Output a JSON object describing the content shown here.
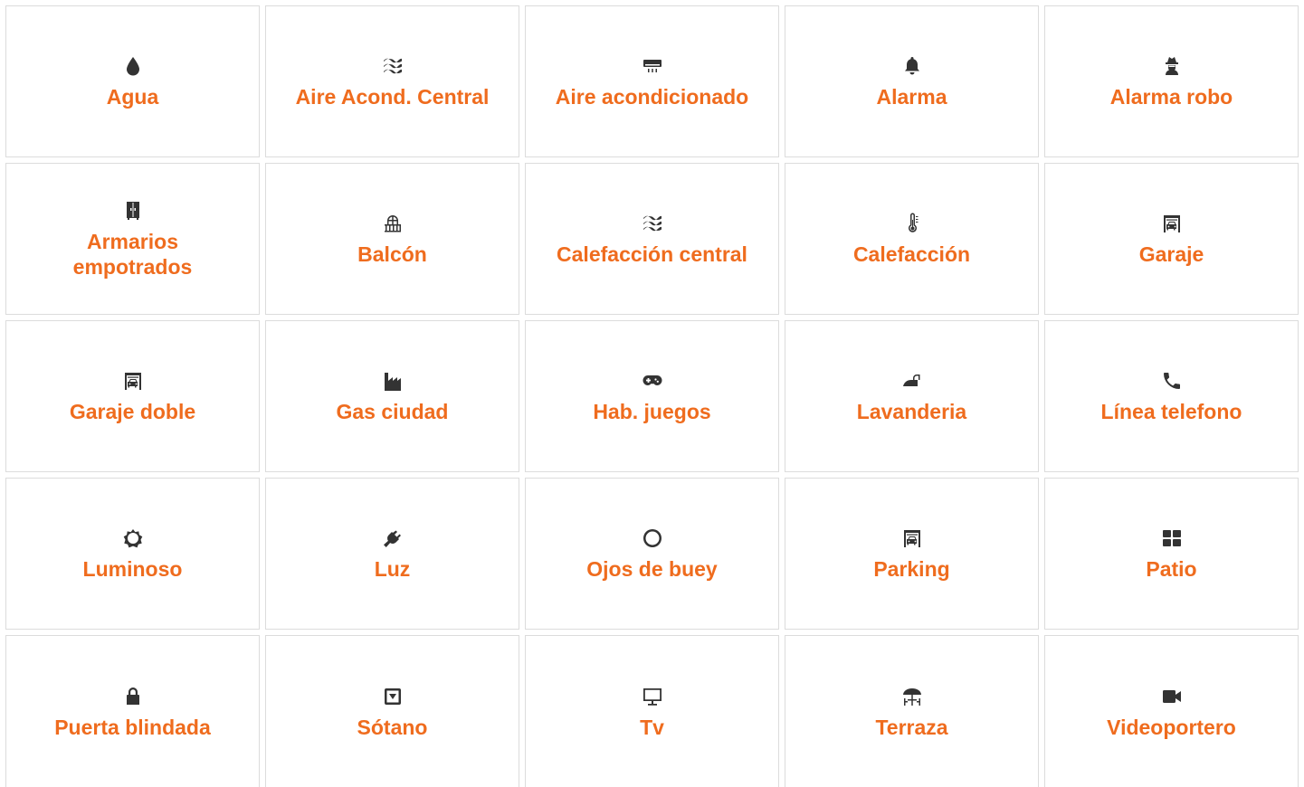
{
  "amenities": [
    {
      "label": "Agua",
      "icon": "water-drop-icon"
    },
    {
      "label": "Aire Acond. Central",
      "icon": "waves-icon"
    },
    {
      "label": "Aire acondicionado",
      "icon": "air-conditioner-icon"
    },
    {
      "label": "Alarma",
      "icon": "bell-icon"
    },
    {
      "label": "Alarma robo",
      "icon": "burglar-icon"
    },
    {
      "label": "Armarios empotrados",
      "icon": "wardrobe-icon"
    },
    {
      "label": "Balcón",
      "icon": "balcony-icon"
    },
    {
      "label": "Calefacción central",
      "icon": "waves-icon"
    },
    {
      "label": "Calefacción",
      "icon": "thermometer-icon"
    },
    {
      "label": "Garaje",
      "icon": "garage-icon"
    },
    {
      "label": "Garaje doble",
      "icon": "garage-icon"
    },
    {
      "label": "Gas ciudad",
      "icon": "factory-icon"
    },
    {
      "label": "Hab. juegos",
      "icon": "gamepad-icon"
    },
    {
      "label": "Lavanderia",
      "icon": "iron-icon"
    },
    {
      "label": "Línea telefono",
      "icon": "phone-icon"
    },
    {
      "label": "Luminoso",
      "icon": "sun-outline-icon"
    },
    {
      "label": "Luz",
      "icon": "plug-icon"
    },
    {
      "label": "Ojos de buey",
      "icon": "circle-outline-icon"
    },
    {
      "label": "Parking",
      "icon": "garage-icon"
    },
    {
      "label": "Patio",
      "icon": "grid-tiles-icon"
    },
    {
      "label": "Puerta blindada",
      "icon": "lock-icon"
    },
    {
      "label": "Sótano",
      "icon": "basement-icon"
    },
    {
      "label": "Tv",
      "icon": "monitor-icon"
    },
    {
      "label": "Terraza",
      "icon": "terrace-umbrella-icon"
    },
    {
      "label": "Videoportero",
      "icon": "video-camera-icon"
    }
  ]
}
